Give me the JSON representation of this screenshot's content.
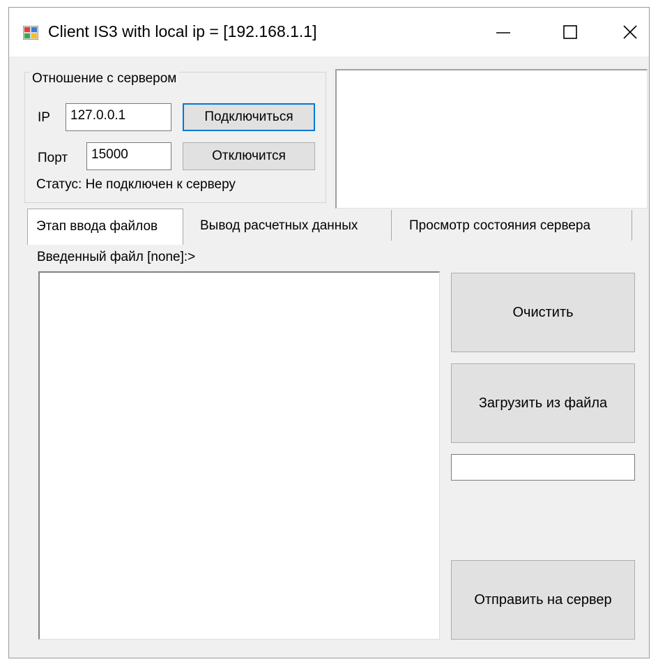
{
  "window": {
    "title": "Client IS3 with local ip = [192.168.1.1]",
    "icon": "app-window-icon",
    "controls": [
      "minimize-icon",
      "maximize-icon",
      "close-icon"
    ]
  },
  "connection": {
    "group_title": "Отношение с сервером",
    "ip_label": "IP",
    "ip_value": "127.0.0.1",
    "port_label": "Порт",
    "port_value": "15000",
    "connect_label": "Подключиться",
    "disconnect_label": "Отключится",
    "status_text": "Статус: Не подключен к серверу"
  },
  "tabs": [
    {
      "label": "Этап ввода файлов",
      "active": true
    },
    {
      "label": "Вывод расчетных данных",
      "active": false
    },
    {
      "label": "Просмотр состояния сервера",
      "active": false
    }
  ],
  "input_panel": {
    "file_label": "Введенный файл [none]:>",
    "file_content": "",
    "clear_label": "Очистить",
    "load_label": "Загрузить из файла",
    "filename_value": "",
    "send_label": "Отправить на сервер"
  },
  "colors": {
    "window_bg": "#f0f0f0",
    "button_bg": "#e1e1e1",
    "focus_border": "#0078d7"
  }
}
